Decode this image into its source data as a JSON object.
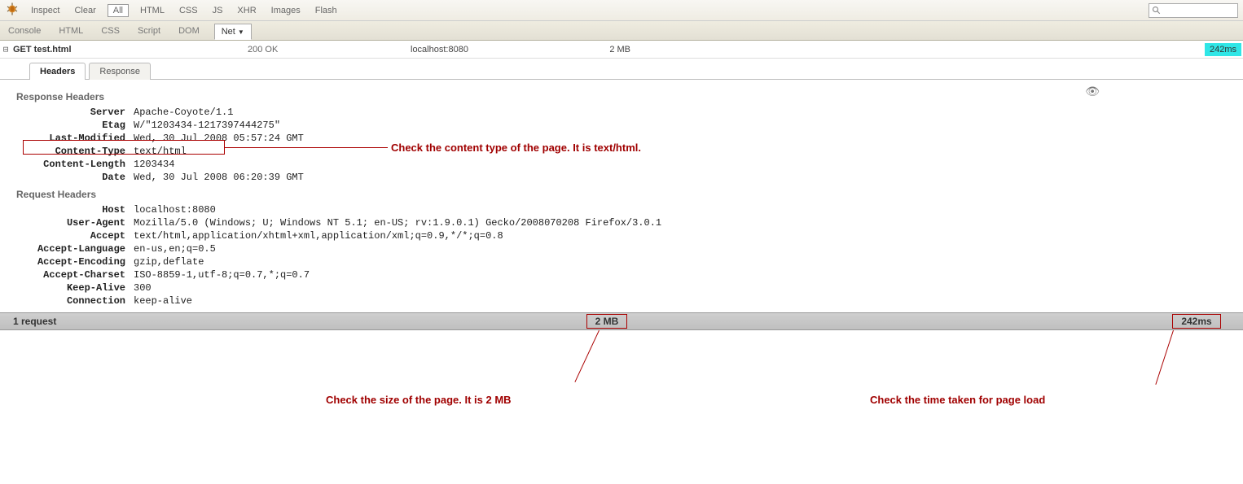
{
  "toolbar": {
    "inspect": "Inspect",
    "clear": "Clear",
    "filters": [
      "All",
      "HTML",
      "CSS",
      "JS",
      "XHR",
      "Images",
      "Flash"
    ],
    "active_filter": "All"
  },
  "panel_tabs": {
    "items": [
      "Console",
      "HTML",
      "CSS",
      "Script",
      "DOM",
      "Net"
    ],
    "active": "Net"
  },
  "request": {
    "toggle": "⊟",
    "method_url": "GET test.html",
    "status": "200 OK",
    "domain": "localhost:8080",
    "size": "2 MB",
    "time": "242ms"
  },
  "subtabs": {
    "items": [
      "Headers",
      "Response"
    ],
    "active": "Headers"
  },
  "response_headers_title": "Response Headers",
  "response_headers": [
    {
      "name": "Server",
      "value": "Apache-Coyote/1.1"
    },
    {
      "name": "Etag",
      "value": "W/\"1203434-1217397444275\""
    },
    {
      "name": "Last-Modified",
      "value": "Wed, 30 Jul 2008 05:57:24 GMT"
    },
    {
      "name": "Content-Type",
      "value": "text/html"
    },
    {
      "name": "Content-Length",
      "value": "1203434"
    },
    {
      "name": "Date",
      "value": "Wed, 30 Jul 2008 06:20:39 GMT"
    }
  ],
  "request_headers_title": "Request Headers",
  "request_headers": [
    {
      "name": "Host",
      "value": "localhost:8080"
    },
    {
      "name": "User-Agent",
      "value": "Mozilla/5.0 (Windows; U; Windows NT 5.1; en-US; rv:1.9.0.1) Gecko/2008070208 Firefox/3.0.1"
    },
    {
      "name": "Accept",
      "value": "text/html,application/xhtml+xml,application/xml;q=0.9,*/*;q=0.8"
    },
    {
      "name": "Accept-Language",
      "value": "en-us,en;q=0.5"
    },
    {
      "name": "Accept-Encoding",
      "value": "gzip,deflate"
    },
    {
      "name": "Accept-Charset",
      "value": "ISO-8859-1,utf-8;q=0.7,*;q=0.7"
    },
    {
      "name": "Keep-Alive",
      "value": "300"
    },
    {
      "name": "Connection",
      "value": "keep-alive"
    }
  ],
  "summary": {
    "requests": "1 request",
    "size": "2 MB",
    "time": "242ms"
  },
  "annotations": {
    "content_type": "Check the content type of the page. It is text/html.",
    "size": "Check the size of the page. It is 2 MB",
    "time": "Check the time taken for page load"
  }
}
